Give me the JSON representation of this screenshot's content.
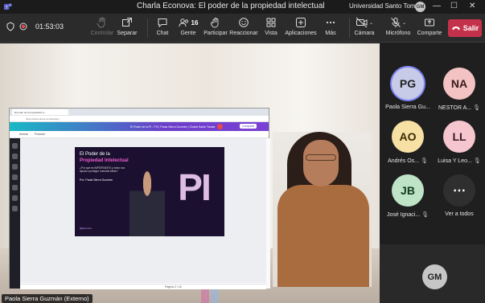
{
  "window": {
    "title": "Charla Econova: El poder de la propiedad intelectual",
    "org": "Universidad Santo Tomás",
    "user_initials": "GM",
    "minimize": "—",
    "maximize": "☐",
    "close": "✕"
  },
  "toolbar": {
    "timer": "01:53:03",
    "items": [
      {
        "label": "Controlar",
        "icon": "hand-icon",
        "disabled": true
      },
      {
        "label": "Separar",
        "icon": "pop-out-icon"
      },
      {
        "label": "Chat",
        "icon": "chat-icon"
      },
      {
        "label": "Gente",
        "icon": "people-icon",
        "badge": "16"
      },
      {
        "label": "Participar",
        "icon": "raise-hand-icon"
      },
      {
        "label": "Reaccionar",
        "icon": "react-icon"
      },
      {
        "label": "Vista",
        "icon": "grid-icon"
      },
      {
        "label": "Aplicaciones",
        "icon": "plus-icon"
      },
      {
        "label": "Más",
        "icon": "more-icon"
      },
      {
        "label": "Cámara",
        "icon": "camera-off-icon"
      },
      {
        "label": "Micrófono",
        "icon": "mic-off-icon"
      },
      {
        "label": "Comparte",
        "icon": "share-icon"
      }
    ],
    "leave_label": "Salir"
  },
  "stage": {
    "presenter_name": "Paola Sierra Guzmán (Externo)",
    "shared": {
      "tab_title": "El poder de la propiedad int...",
      "url": "https://www.canva.com/design/...",
      "canva_title": "El Poder de la PI - PG | Paola Sierra Guzmán | Charla Santo Tomás",
      "share_button": "Compartir",
      "sub_left": "Animar",
      "sub_mid": "Posición",
      "slide": {
        "line1": "El Poder de la",
        "line2": "Propiedad Intelectual",
        "line3": "¿Por qué es IMPORTANTE y cómo nos ayuda a proteger nuestras ideas?",
        "line4": "Por: Paola Sierra Guzmán",
        "pi": "PI",
        "footer": "@Econova"
      },
      "page_info": "Página 2 / 16"
    }
  },
  "roster": {
    "participants": [
      {
        "initials": "PG",
        "name": "Paola Sierra Gu...",
        "color": "#c8cbe8",
        "text": "#222",
        "muted": false,
        "speaking": true
      },
      {
        "initials": "NA",
        "name": "NESTOR A...",
        "color": "#f3c2c2",
        "text": "#3a1a1a",
        "muted": true
      },
      {
        "initials": "AO",
        "name": "Andrés Os...",
        "color": "#f6e0a4",
        "text": "#3a2c00",
        "muted": true
      },
      {
        "initials": "LL",
        "name": "Luisa Y Leo...",
        "color": "#f6c6cf",
        "text": "#3a1a20",
        "muted": true
      },
      {
        "initials": "JB",
        "name": "José Ignaci...",
        "color": "#bfe3c7",
        "text": "#0f3a1c",
        "muted": true
      },
      {
        "initials": "⋯",
        "name": "Ver a todos",
        "color": "#2f2f2f",
        "text": "#fff",
        "muted": false
      }
    ],
    "self_initials": "GM"
  }
}
